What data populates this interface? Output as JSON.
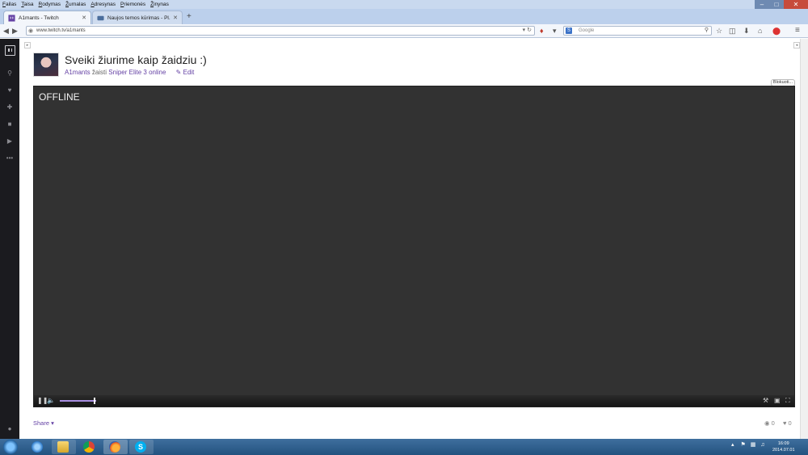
{
  "browser": {
    "menu": [
      "Failas",
      "Taisa",
      "Rodymas",
      "Žurnalas",
      "Adresynas",
      "Priemonės",
      "Žinynas"
    ],
    "tabs": [
      {
        "title": "A1mants - Twitch",
        "active": true
      },
      {
        "title": "Naujos temos kūrimas - Pl...",
        "active": false
      }
    ],
    "url": "www.twitch.tv/a1mants",
    "search_placeholder": "Google"
  },
  "stream": {
    "title": "Sveiki žiurime kaip žaidziu :)",
    "streamer": "A1mants",
    "playing_word": "žaisti",
    "game": "Sniper Elite 3 online",
    "edit_label": "Edit",
    "status": "OFFLINE",
    "popout_label": "Blokuoti...",
    "share_label": "Share",
    "viewers": "0",
    "follows": "0",
    "volume_level": 1.0
  },
  "colors": {
    "twitch_purple": "#6441a4",
    "player_bg": "#323232",
    "rail_bg": "#1b1b1f",
    "volume_accent": "#a88ee0"
  },
  "taskbar": {
    "time": "16:09",
    "date": "2014.07.01",
    "pinned": [
      "ie-icon",
      "folder-icon",
      "chrome-icon",
      "firefox-icon",
      "skype-icon"
    ]
  }
}
